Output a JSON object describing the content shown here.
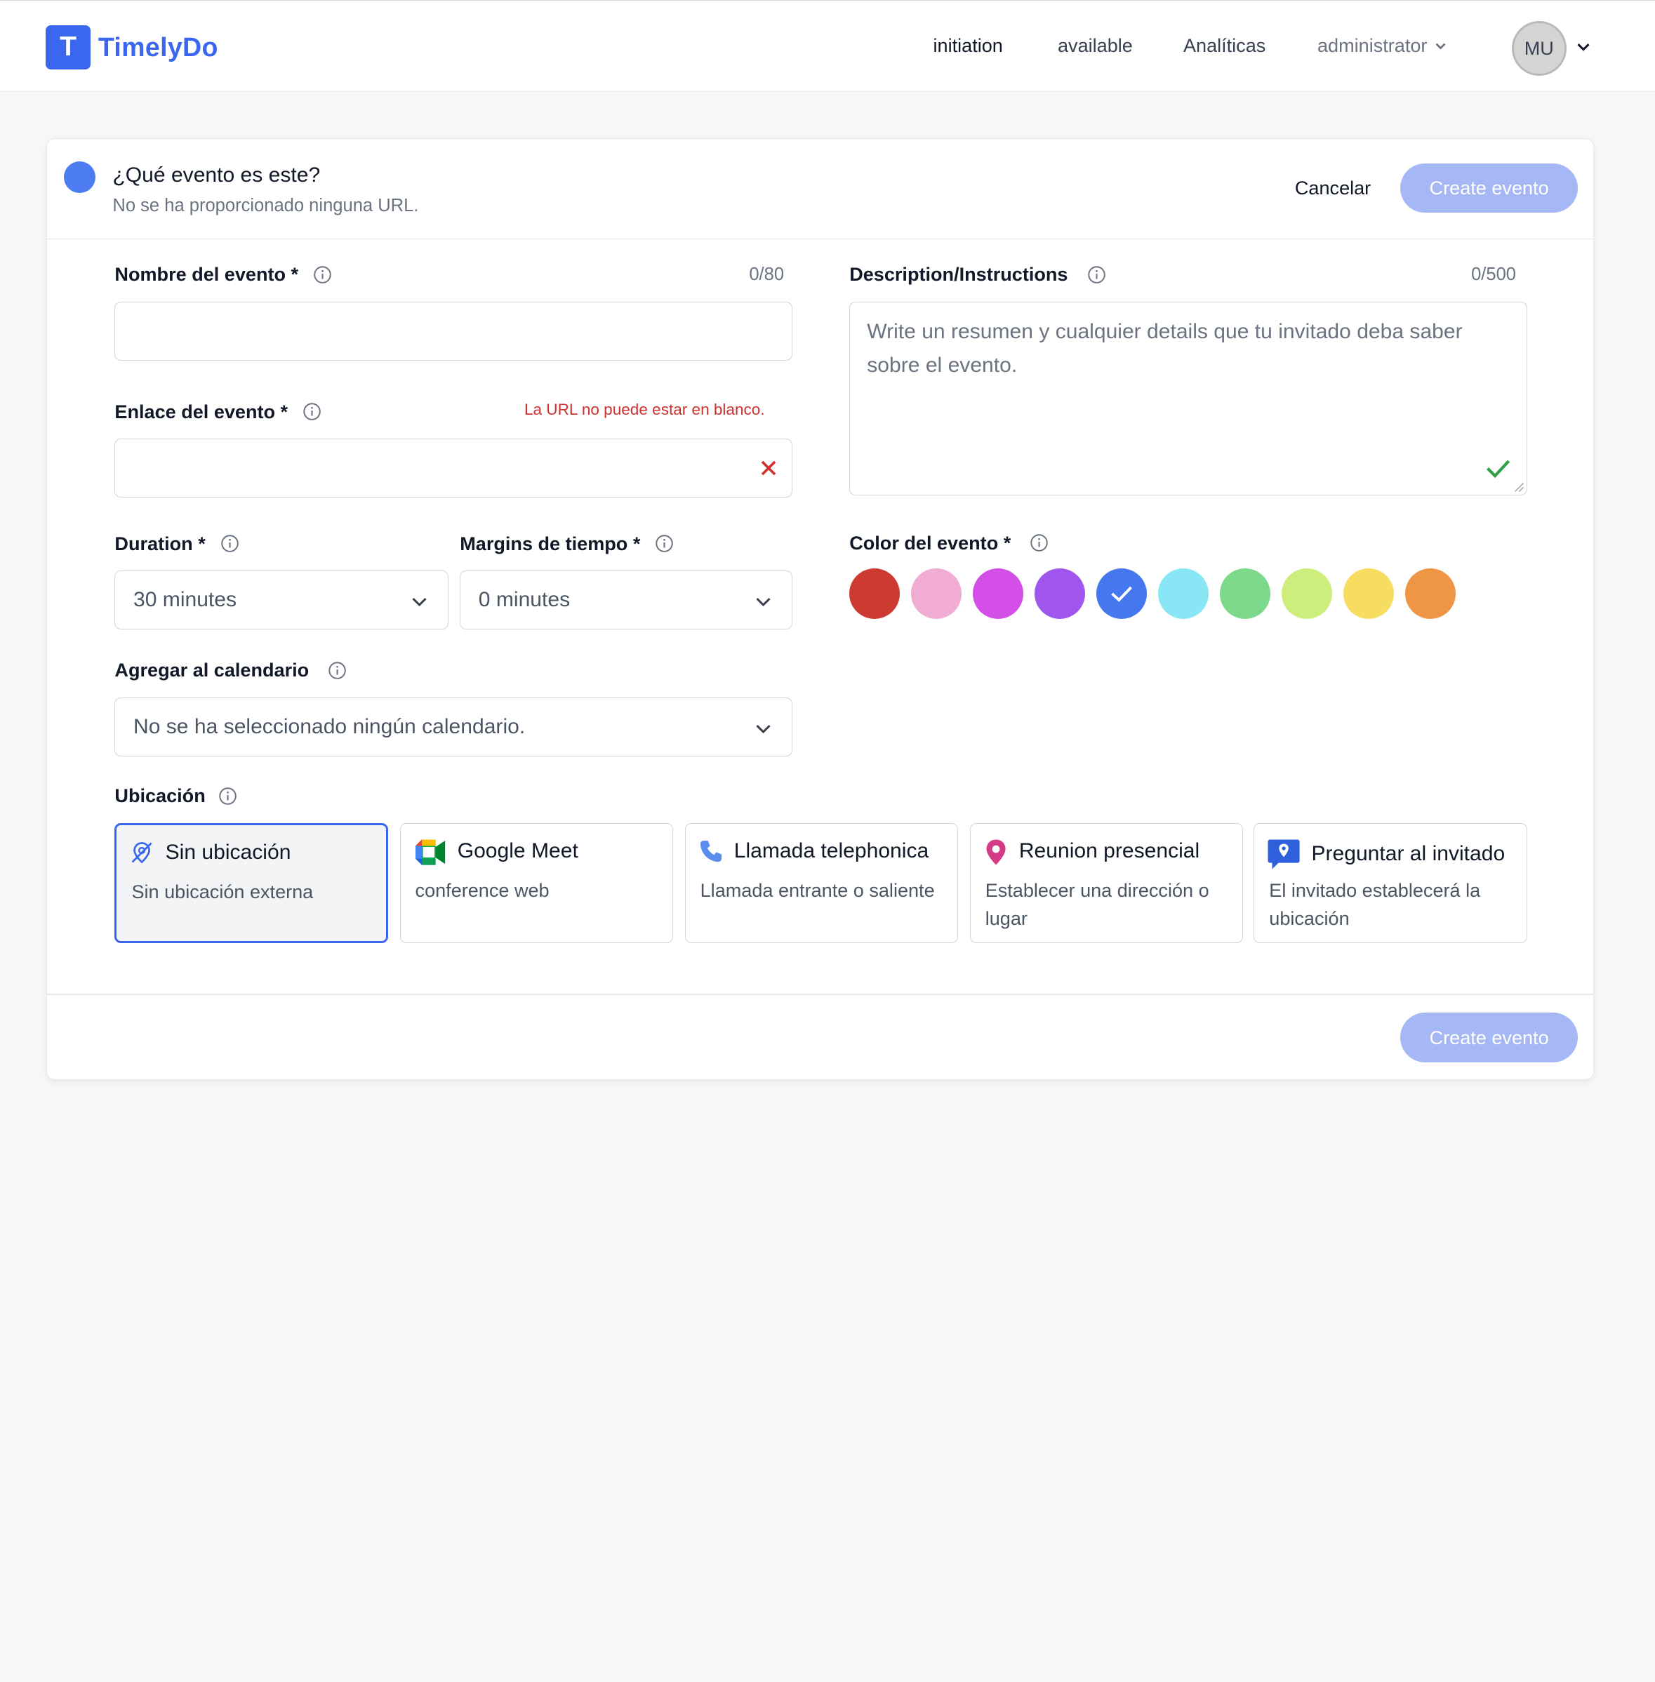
{
  "app": {
    "logo_letter": "T",
    "name": "TimelyDo",
    "accent": "#3b67f0"
  },
  "nav": {
    "initiation": "initiation",
    "available": "available",
    "analytics": "Analíticas",
    "admin": "administrator",
    "avatar_initials": "MU"
  },
  "header": {
    "title": "¿Qué evento es este?",
    "subtitle": "No se ha proporcionado ninguna URL.",
    "cancel": "Cancelar",
    "create": "Create evento"
  },
  "form": {
    "name_label": "Nombre del evento *",
    "name_counter": "0/80",
    "name_value": "",
    "link_label": "Enlace del evento *",
    "link_error": "La URL no puede estar en blanco.",
    "link_value": "",
    "duration_label": "Duration *",
    "duration_value": "30 minutes",
    "margins_label": "Margins de tiempo *",
    "margins_value": "0 minutes",
    "calendar_label": "Agregar al calendario",
    "calendar_value": "No se ha seleccionado ningún calendario.",
    "desc_label": "Description/Instructions",
    "desc_counter": "0/500",
    "desc_placeholder": "Write un resumen y cualquier details que tu invitado deba saber sobre el evento.",
    "color_label": "Color del evento *",
    "colors": [
      "#cd3a31",
      "#f0acd3",
      "#d44ee8",
      "#a056ec",
      "#4577ee",
      "#88e6f5",
      "#7cd88a",
      "#cdee7c",
      "#f7dc62",
      "#ee9546"
    ],
    "selected_color": "#4577ee",
    "location_label": "Ubicación"
  },
  "locations": [
    {
      "title": "Sin ubicación",
      "desc": "Sin ubicación externa",
      "icon": "no-location-icon",
      "selected": true
    },
    {
      "title": "Google Meet",
      "desc": "conference web",
      "icon": "google-meet-icon",
      "selected": false
    },
    {
      "title": "Llamada telephonica",
      "desc": "Llamada entrante o saliente",
      "icon": "phone-icon",
      "selected": false
    },
    {
      "title": "Reunion presencial",
      "desc": "Establecer una dirección o lugar",
      "icon": "map-pin-icon",
      "selected": false
    },
    {
      "title": "Preguntar al invitado",
      "desc": "El invitado establecerá la ubicación",
      "icon": "ask-invitee-icon",
      "selected": false
    }
  ],
  "footer": {
    "create": "Create evento"
  }
}
